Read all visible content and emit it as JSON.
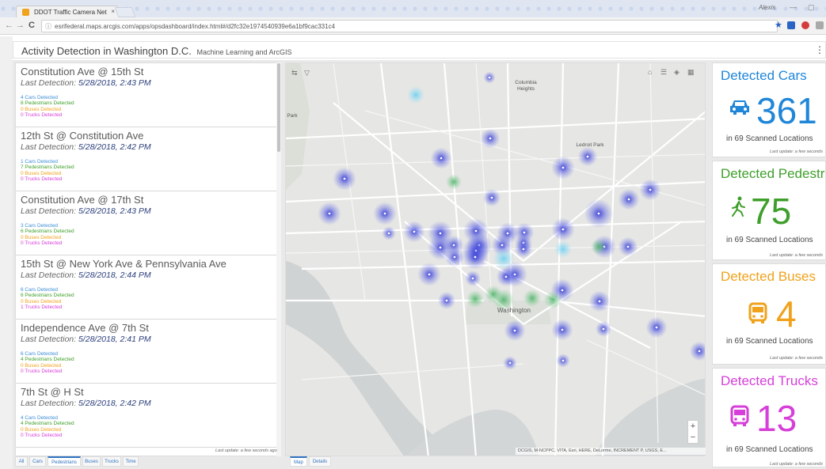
{
  "browser": {
    "tab_title": "DDOT Traffic Camera Net",
    "tab_close": "×",
    "url": "esrifederal.maps.arcgis.com/apps/opsdashboard/index.html#/d2fc32e1974540939e6a1bf9cac331c4",
    "user": "Alexis",
    "min": "—",
    "restore": "▢",
    "back": "←",
    "forward": "→",
    "reload": "C",
    "info": "ⓘ",
    "star": "★"
  },
  "header": {
    "title": "Activity Detection in Washington D.C.",
    "subtitle": "Machine Learning and ArcGIS",
    "menu": "⋮"
  },
  "list": {
    "detection_prefix": "Last Detection:",
    "items": [
      {
        "title": "Constitution Ave @ 15th St",
        "detection": "5/28/2018, 2:43 PM",
        "cars": "4 Cars Detected",
        "peds": "8 Pedestrians Detected",
        "buses": "0 Buses Detected",
        "trucks": "0 Trucks Detected"
      },
      {
        "title": "12th St @ Constitution Ave",
        "detection": "5/28/2018, 2:42 PM",
        "cars": "1 Cars Detected",
        "peds": "7 Pedestrians Detected",
        "buses": "0 Buses Detected",
        "trucks": "0 Trucks Detected"
      },
      {
        "title": "Constitution Ave @ 17th St",
        "detection": "5/28/2018, 2:43 PM",
        "cars": "3 Cars Detected",
        "peds": "6 Pedestrians Detected",
        "buses": "0 Buses Detected",
        "trucks": "0 Trucks Detected"
      },
      {
        "title": "15th St @ New York Ave & Pennsylvania Ave",
        "detection": "5/28/2018, 2:44 PM",
        "cars": "6 Cars Detected",
        "peds": "6 Pedestrians Detected",
        "buses": "0 Buses Detected",
        "trucks": "1 Trucks Detected"
      },
      {
        "title": "Independence Ave @ 7th St",
        "detection": "5/28/2018, 2:41 PM",
        "cars": "6 Cars Detected",
        "peds": "4 Pedestrians Detected",
        "buses": "0 Buses Detected",
        "trucks": "0 Trucks Detected"
      },
      {
        "title": "7th St @ H St",
        "detection": "5/28/2018, 2:42 PM",
        "cars": "4 Cars Detected",
        "peds": "4 Pedestrians Detected",
        "buses": "0 Buses Detected",
        "trucks": "0 Trucks Detected"
      }
    ],
    "last_update": "Last update: a few seconds ago",
    "tabs": [
      "All",
      "Cars",
      "Pedestrians",
      "Buses",
      "Trucks",
      "Time"
    ],
    "active_tab": "Pedestrians"
  },
  "map": {
    "labels": {
      "columbia": "Columbia",
      "heights": "Heights",
      "ledroit": "Ledroit Park",
      "park": "Park",
      "washington": "Washington"
    },
    "tools": {
      "layers": "▤",
      "home": "⌂",
      "legend": "☰",
      "basemap": "◈",
      "grid": "▦",
      "toggle": "⇆",
      "down": "▽"
    },
    "zoom_in": "+",
    "zoom_out": "−",
    "attribution": "DCGIS, M-NCPPC, VITA, Esri, HERE, DeLorme, INCREMENT P, USGS, E...",
    "tabs": [
      "Map",
      "Details"
    ],
    "active_tab": "Map"
  },
  "indicators": [
    {
      "title": "Detected Cars",
      "value": "361",
      "sub": "in 69 Scanned Locations",
      "update": "Last update: a few seconds",
      "color": "#1f86d8",
      "icon": "car-icon"
    },
    {
      "title": "Detected Pedestrians",
      "value": "75",
      "sub": "in 69 Scanned Locations",
      "update": "Last update: a few seconds",
      "color": "#3f9f2b",
      "icon": "pedestrian-icon"
    },
    {
      "title": "Detected Buses",
      "value": "4",
      "sub": "in 69 Scanned Locations",
      "update": "Last update: a few seconds",
      "color": "#f0a21c",
      "icon": "bus-icon"
    },
    {
      "title": "Detected Trucks",
      "value": "13",
      "sub": "in 69 Scanned Locations",
      "update": "Last update: a few seconds",
      "color": "#d63fd9",
      "icon": "truck-icon"
    }
  ]
}
